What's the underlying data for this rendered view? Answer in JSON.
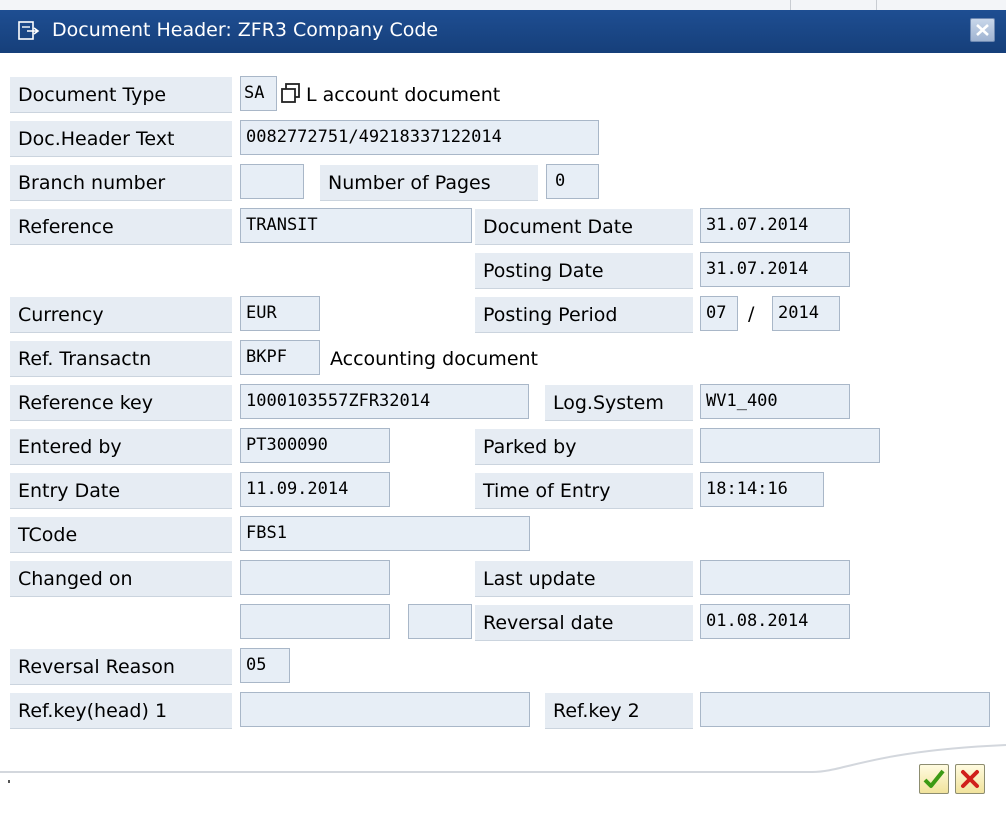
{
  "window": {
    "title": "Document Header: ZFR3 Company Code",
    "title_icon": "document-header-icon",
    "close_icon": "close-icon"
  },
  "form": {
    "document_type": {
      "label": "Document Type",
      "value": "SA",
      "description": "L account document"
    },
    "doc_header_text": {
      "label": "Doc.Header Text",
      "value": "0082772751/49218337122014"
    },
    "branch_number": {
      "label": "Branch number",
      "value": ""
    },
    "number_of_pages": {
      "label": "Number of Pages",
      "value": "0"
    },
    "reference": {
      "label": "Reference",
      "value": "TRANSIT"
    },
    "document_date": {
      "label": "Document Date",
      "value": "31.07.2014"
    },
    "posting_date": {
      "label": "Posting Date",
      "value": "31.07.2014"
    },
    "currency": {
      "label": "Currency",
      "value": "EUR"
    },
    "posting_period": {
      "label": "Posting Period",
      "period": "07",
      "separator": "/",
      "year": "2014"
    },
    "ref_transaction": {
      "label": "Ref. Transactn",
      "value": "BKPF",
      "description": "Accounting document"
    },
    "reference_key": {
      "label": "Reference key",
      "value": "1000103557ZFR32014"
    },
    "log_system": {
      "label": "Log.System",
      "value": "WV1_400"
    },
    "entered_by": {
      "label": "Entered by",
      "value": "PT300090"
    },
    "parked_by": {
      "label": "Parked by",
      "value": ""
    },
    "entry_date": {
      "label": "Entry Date",
      "value": "11.09.2014"
    },
    "time_of_entry": {
      "label": "Time of Entry",
      "value": "18:14:16"
    },
    "tcode": {
      "label": "TCode",
      "value": "FBS1"
    },
    "changed_on": {
      "label": "Changed on",
      "value": ""
    },
    "last_update": {
      "label": "Last update",
      "value": ""
    },
    "extra_field_1": {
      "value": ""
    },
    "extra_field_2": {
      "value": ""
    },
    "reversal_date": {
      "label": "Reversal date",
      "value": "01.08.2014"
    },
    "reversal_reason": {
      "label": "Reversal Reason",
      "value": "05"
    },
    "ref_key_head_1": {
      "label": "Ref.key(head) 1",
      "value": ""
    },
    "ref_key_2": {
      "label": "Ref.key 2",
      "value": ""
    }
  },
  "buttons": {
    "continue_icon": "checkmark-icon",
    "cancel_icon": "cancel-x-icon"
  },
  "colors": {
    "title_bar": "#1e4e92",
    "label_bg": "#e6ecf3",
    "field_bg": "#e7eef6",
    "field_border": "#a9b7c8"
  }
}
